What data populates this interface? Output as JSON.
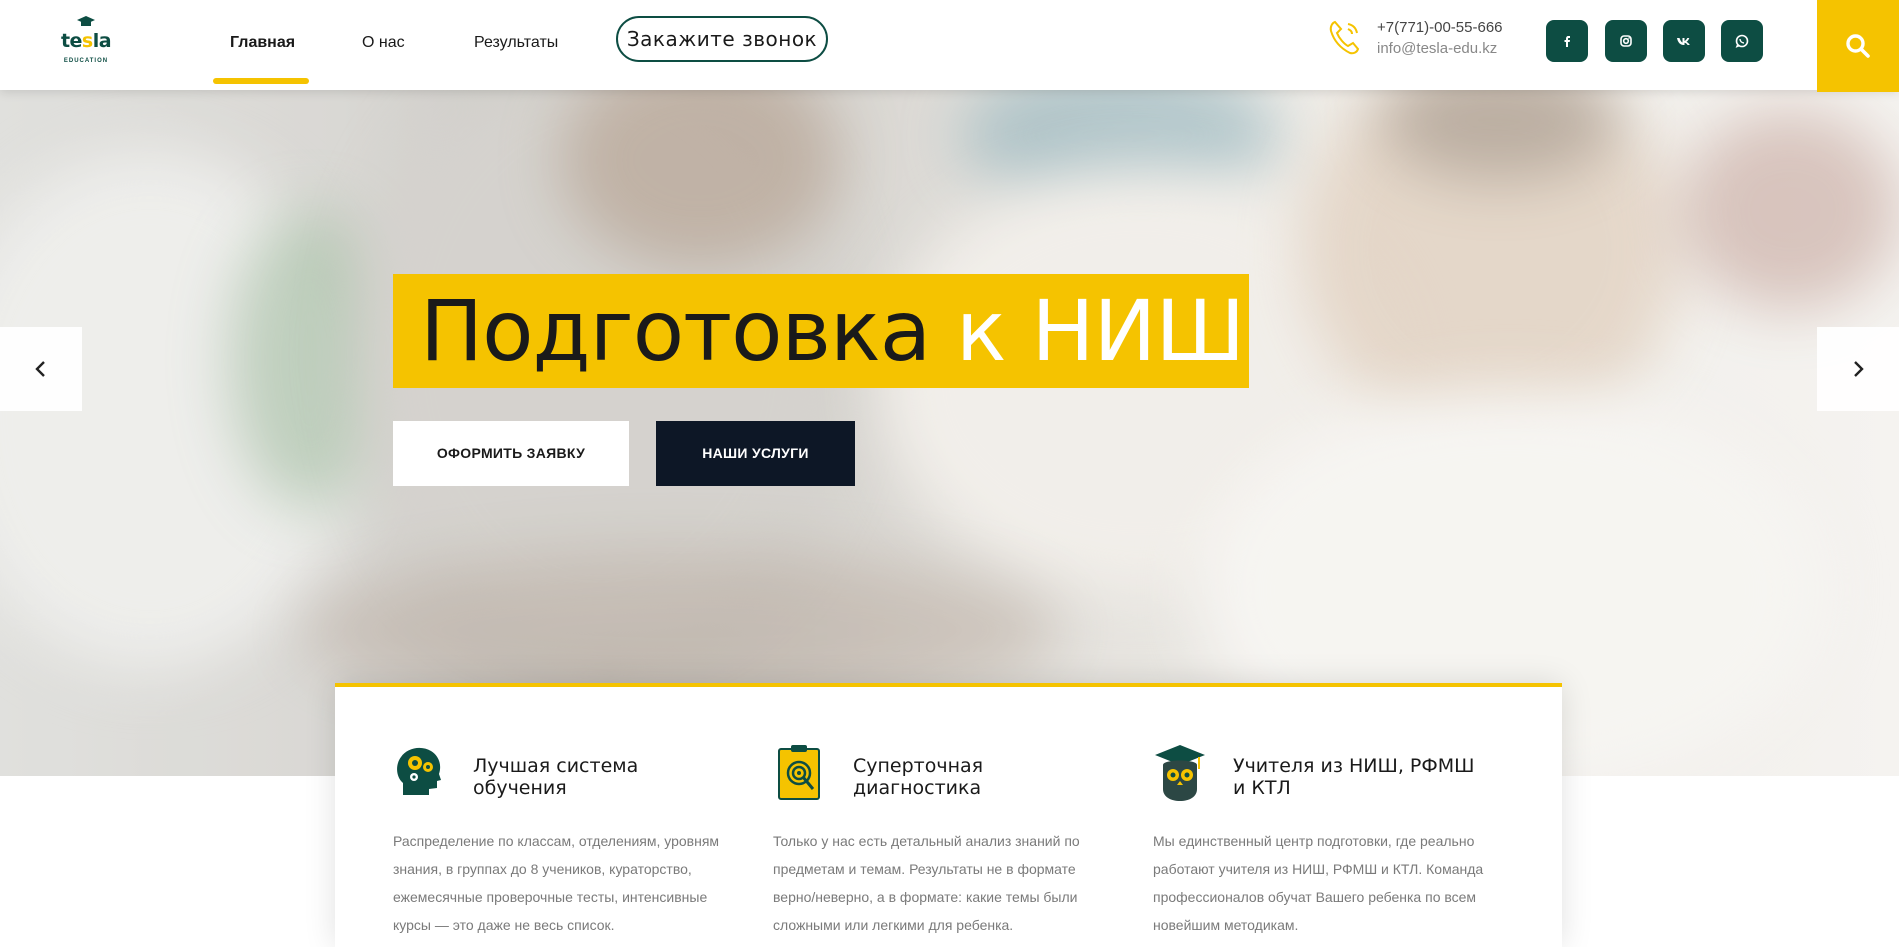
{
  "logo": {
    "text_start": "te",
    "text_mid": "s",
    "text_end": "la",
    "subtext": "EDUCATION"
  },
  "nav": {
    "items": [
      {
        "label": "Главная",
        "active": true
      },
      {
        "label": "О нас",
        "active": false
      },
      {
        "label": "Результаты",
        "active": false
      }
    ],
    "call_button": "Закажите звонок"
  },
  "contact": {
    "phone": "+7(771)-00-55-666",
    "email": "info@tesla-edu.kz",
    "phone_icon": "phone-icon"
  },
  "social": [
    "facebook-icon",
    "instagram-icon",
    "vk-icon",
    "whatsapp-icon"
  ],
  "search_icon": "search-icon",
  "hero": {
    "title_dark": "Подготовка",
    "title_light": "к НИШ",
    "btn_apply": "ОФОРМИТЬ ЗАЯВКУ",
    "btn_services": "НАШИ УСЛУГИ",
    "prev_icon": "chevron-left-icon",
    "next_icon": "chevron-right-icon"
  },
  "features": [
    {
      "icon": "brain-gears-icon",
      "title": "Лучшая система обучения",
      "text": "Распределение по классам, отделениям, уровням знания, в группах до 8 учеников, кураторство, ежемесячные проверочные тесты, интенсивные курсы — это даже не весь список."
    },
    {
      "icon": "target-report-icon",
      "title": "Суперточная диагностика",
      "text": "Только у нас есть детальный анализ знаний по предметам и темам. Результаты не в формате верно/неверно, а в формате: какие темы были сложными или легкими для ребенка."
    },
    {
      "icon": "owl-graduate-icon",
      "title": "Учителя из НИШ, РФМШ и КТЛ",
      "text": "Мы единственный центр подготовки, где реально работают учителя из НИШ, РФМШ и КТЛ. Команда профессионалов обучат Вашего ребенка по всем новейшим методикам."
    }
  ],
  "colors": {
    "accent": "#f5c300",
    "brand": "#0d4d43",
    "dark": "#0d1726"
  }
}
